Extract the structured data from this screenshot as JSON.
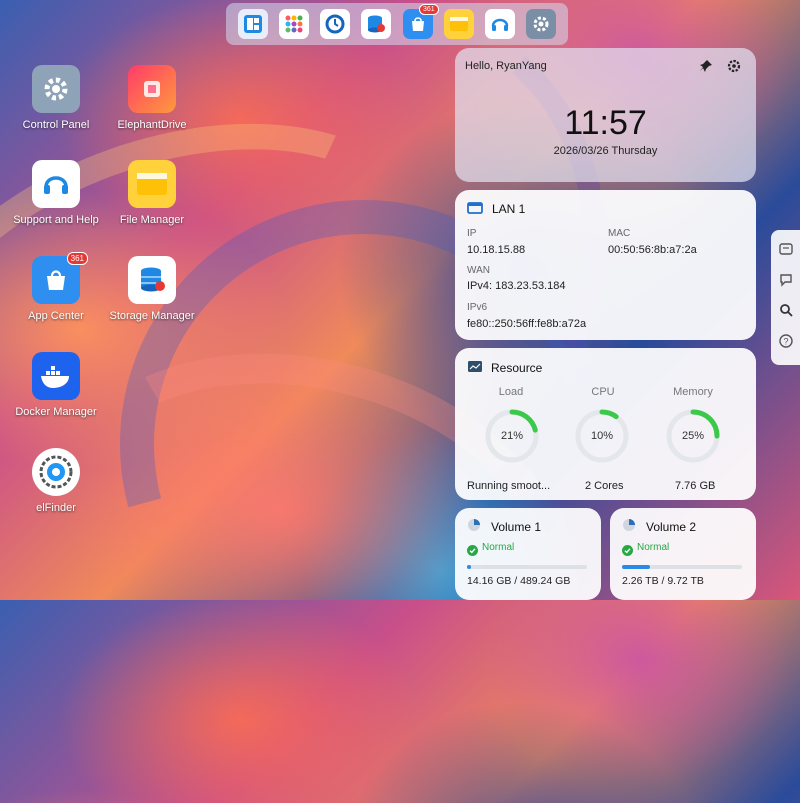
{
  "dock": {
    "items": [
      {
        "name": "control-panel-dock-icon"
      },
      {
        "name": "app-grid-dock-icon"
      },
      {
        "name": "backup-dock-icon"
      },
      {
        "name": "storage-dock-icon"
      },
      {
        "name": "app-center-dock-icon",
        "badge": "361"
      },
      {
        "name": "file-manager-dock-icon"
      },
      {
        "name": "support-dock-icon"
      },
      {
        "name": "settings-dock-icon"
      }
    ]
  },
  "desktop": {
    "icons": [
      {
        "label": "Control Panel"
      },
      {
        "label": "ElephantDrive"
      },
      {
        "label": "Support and Help"
      },
      {
        "label": "File Manager"
      },
      {
        "label": "App Center",
        "badge": "361"
      },
      {
        "label": "Storage Manager"
      },
      {
        "label": "Docker Manager"
      },
      {
        "label": "elFinder"
      }
    ]
  },
  "clock": {
    "greeting": "Hello, RyanYang",
    "time": "11:57",
    "date": "2026/03/26 Thursday"
  },
  "lan": {
    "title": "LAN 1",
    "ip_label": "IP",
    "ip": "10.18.15.88",
    "mac_label": "MAC",
    "mac": "00:50:56:8b:a7:2a",
    "wan_label": "WAN",
    "wan": "IPv4: 183.23.53.184",
    "ipv6_label": "IPv6",
    "ipv6": "fe80::250:56ff:fe8b:a72a"
  },
  "resource": {
    "title": "Resource",
    "load": {
      "label": "Load",
      "percent": 21,
      "text": "21%",
      "footer": "Running smoot..."
    },
    "cpu": {
      "label": "CPU",
      "percent": 10,
      "text": "10%",
      "footer": "2 Cores"
    },
    "memory": {
      "label": "Memory",
      "percent": 25,
      "text": "25%",
      "footer": "7.76 GB"
    }
  },
  "volumes": [
    {
      "title": "Volume 1",
      "status": "Normal",
      "usage": "14.16 GB / 489.24 GB",
      "fraction": 0.03
    },
    {
      "title": "Volume 2",
      "status": "Normal",
      "usage": "2.26 TB / 9.72 TB",
      "fraction": 0.23
    }
  ],
  "colors": {
    "accent": "#2b8ae6",
    "ring": "#3cc84a",
    "normal": "#27a844"
  }
}
